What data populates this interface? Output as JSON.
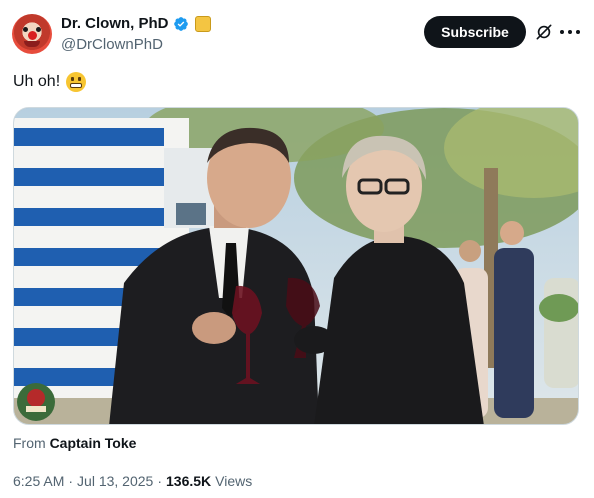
{
  "author": {
    "display_name": "Dr. Clown, PhD",
    "handle": "@DrClownPhD",
    "verified_icon": "verified-badge-icon",
    "affiliate_icon": "affiliate-badge-icon"
  },
  "actions": {
    "subscribe_label": "Subscribe",
    "grok_icon": "grok-icon",
    "more_icon": "more-options-icon"
  },
  "tweet": {
    "text": "Uh oh!",
    "emoji": "grimacing-face-emoji"
  },
  "media": {
    "type": "video",
    "watermark_icon": "channel-watermark-icon"
  },
  "source": {
    "prefix": "From",
    "name": "Captain Toke"
  },
  "meta": {
    "time": "6:25 AM",
    "sep1": "·",
    "date": "Jul 13, 2025",
    "sep2": "·",
    "views": "136.5K",
    "views_label": "Views"
  },
  "colors": {
    "accent_dark": "#0f1419",
    "secondary_text": "#536471",
    "verified_blue": "#1d9bf0"
  }
}
